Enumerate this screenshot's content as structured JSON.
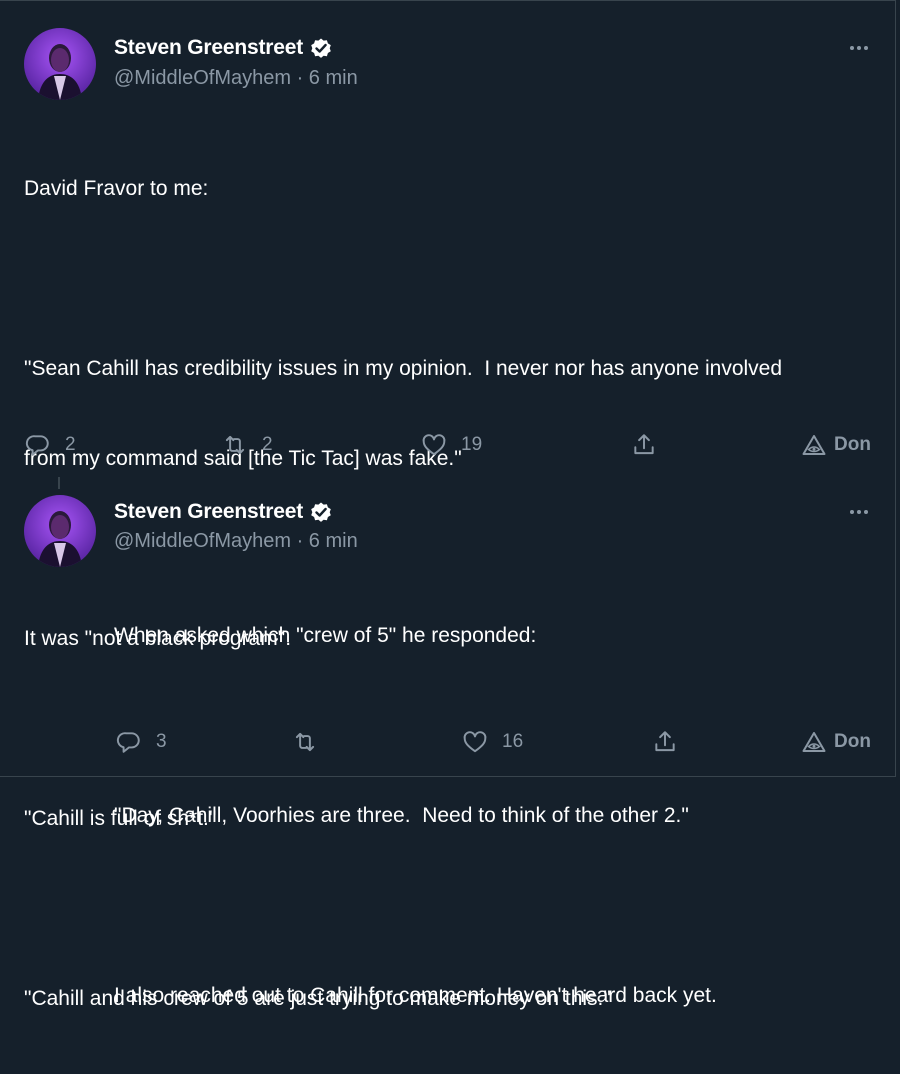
{
  "tweet1": {
    "name": "Steven Greenstreet",
    "handle_time": "@MiddleOfMayhem · 6 min",
    "lines": [
      "David Fravor to me:",
      "",
      "\"Sean Cahill has credibility issues in my opinion.  I never nor has anyone involved",
      "from my command said [the Tic Tac] was fake.\"",
      "",
      "It was \"not a black program\".",
      "",
      "\"Cahill is full of sh*t.\"",
      "",
      "\"Cahill and his crew of 5 are just trying to make money on this.\""
    ],
    "actions": {
      "replies": "2",
      "retweets": "2",
      "likes": "19",
      "don_label": "Don"
    }
  },
  "tweet2": {
    "name": "Steven Greenstreet",
    "handle_time": "@MiddleOfMayhem · 6 min",
    "lines": [
      "When asked which \"crew of 5\" he responded:",
      "",
      "\"Day, Cahill, Voorhies are three.  Need to think of the other 2.\"",
      "",
      "I also reached out to Cahill for comment. Haven't heard back yet."
    ],
    "actions": {
      "replies": "3",
      "retweets": "",
      "likes": "16",
      "don_label": "Don"
    }
  },
  "icons": {
    "reply": "reply-icon",
    "retweet": "retweet-icon",
    "like": "heart-icon",
    "share": "share-icon",
    "don": "triangle-eye-icon",
    "verified": "verified-badge-icon",
    "more": "more-icon"
  },
  "colors": {
    "background": "#15202b",
    "muted": "#8b98a5",
    "text": "#ffffff",
    "border": "#38444d",
    "avatar": "#7e22ce"
  }
}
